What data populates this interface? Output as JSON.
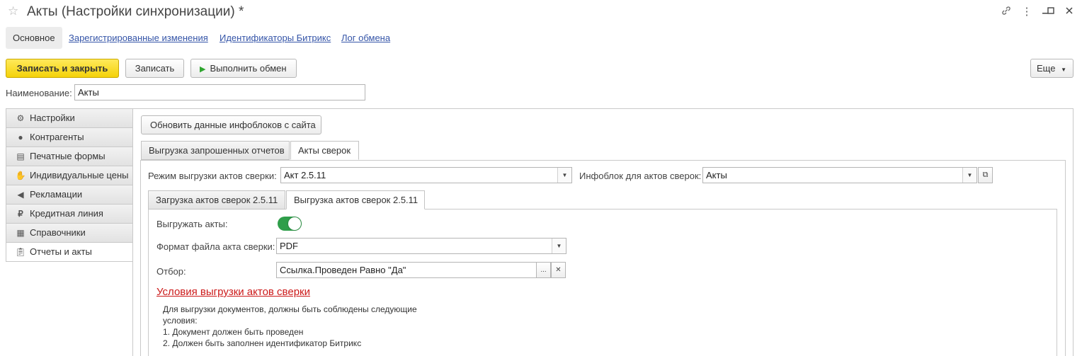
{
  "window": {
    "title": "Акты (Настройки синхронизации) *",
    "icons": [
      "star-icon",
      "link-icon",
      "more-vertical-icon",
      "minimize-icon",
      "maximize-icon",
      "close-icon"
    ]
  },
  "nav": {
    "main": "Основное",
    "links": [
      "Зарегистрированные изменения",
      "Идентификаторы Битрикс",
      "Лог обмена"
    ]
  },
  "toolbar": {
    "save_close": "Записать и закрыть",
    "save": "Записать",
    "run_exchange": "Выполнить обмен",
    "more": "Еще"
  },
  "name_field": {
    "label": "Наименование:",
    "value": "Акты"
  },
  "sidebar": {
    "items": [
      {
        "label": "Настройки",
        "icon": "gear-icon"
      },
      {
        "label": "Контрагенты",
        "icon": "people-icon"
      },
      {
        "label": "Печатные формы",
        "icon": "document-icon"
      },
      {
        "label": "Индивидуальные цены",
        "icon": "handshake-icon"
      },
      {
        "label": "Рекламации",
        "icon": "megaphone-icon"
      },
      {
        "label": "Кредитная линия",
        "icon": "ruble-icon"
      },
      {
        "label": "Справочники",
        "icon": "table-icon"
      },
      {
        "label": "Отчеты и акты",
        "icon": "clipboard-icon"
      }
    ],
    "active_index": 7
  },
  "main": {
    "refresh_button": "Обновить данные инфоблоков с сайта",
    "tabs": [
      "Выгрузка запрошенных отчетов",
      "Акты сверок"
    ],
    "active_tab": 1,
    "mode_label": "Режим выгрузки актов сверки:",
    "mode_value": "Акт 2.5.11",
    "infoblock_label": "Инфоблок для актов сверок:",
    "infoblock_value": "Акты",
    "subtabs": [
      "Загрузка актов сверок 2.5.11",
      "Выгрузка актов сверок 2.5.11"
    ],
    "active_subtab": 1,
    "export_label": "Выгружать акты:",
    "export_enabled": true,
    "format_label": "Формат файла акта сверки:",
    "format_value": "PDF",
    "filter_label": "Отбор:",
    "filter_value": "Ссылка.Проведен Равно \"Да\"",
    "conditions_heading": "Условия выгрузки актов сверки",
    "conditions_lines": [
      "Для выгрузки документов, должны быть соблюдены следующие",
      "условия:",
      "1. Документ должен быть проведен",
      "2. Должен быть заполнен идентификатор Битрикс"
    ]
  },
  "colors": {
    "primary_button": "#f4d20a",
    "link": "#3555a8",
    "toggle_on": "#2f9e4a",
    "heading_red": "#cc1a1a"
  }
}
